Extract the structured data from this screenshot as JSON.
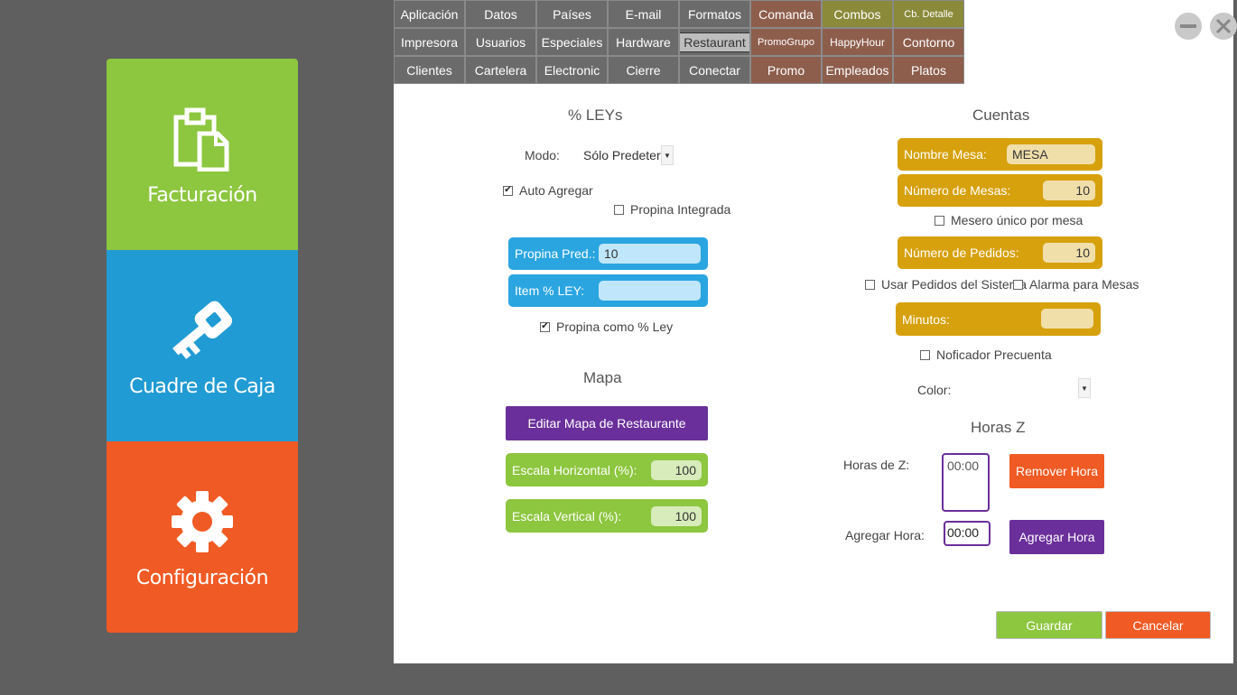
{
  "left_menu": {
    "items": [
      {
        "label": "Facturación",
        "icon": "clipboard-icon"
      },
      {
        "label": "Cuadre de Caja",
        "icon": "key-icon"
      },
      {
        "label": "Configuración",
        "icon": "gear-icon"
      }
    ]
  },
  "tabs": {
    "row1": [
      "Aplicación",
      "Datos",
      "Países",
      "E-mail",
      "Formatos",
      "Comanda",
      "Combos",
      "Cb. Detalle"
    ],
    "row2": [
      "Impresora",
      "Usuarios",
      "Especiales",
      "Hardware",
      "Restaurant",
      "PromoGrupo",
      "HappyHour",
      "Contorno"
    ],
    "row3": [
      "Clientes",
      "Cartelera",
      "Electronic",
      "Cierre",
      "Conectar",
      "Promo",
      "Empleados",
      "Platos"
    ],
    "active": "Restaurant"
  },
  "leys": {
    "title": "% LEYs",
    "modo_label": "Modo:",
    "modo_value": "Sólo Predeterr",
    "auto_agregar": "Auto Agregar",
    "propina_integrada": "Propina Integrada",
    "propina_pred_label": "Propina Pred.:",
    "propina_pred_value": "10",
    "item_ley_label": "Item % LEY:",
    "item_ley_value": "",
    "propina_como_ley": "Propina como % Ley"
  },
  "mapa": {
    "title": "Mapa",
    "edit_button": "Editar Mapa de Restaurante",
    "escala_h_label": "Escala Horizontal (%):",
    "escala_h_value": "100",
    "escala_v_label": "Escala Vertical (%):",
    "escala_v_value": "100"
  },
  "cuentas": {
    "title": "Cuentas",
    "nombre_mesa_label": "Nombre Mesa:",
    "nombre_mesa_value": "MESA",
    "numero_mesas_label": "Número de Mesas:",
    "numero_mesas_value": "10",
    "mesero_unico": "Mesero único por mesa",
    "numero_pedidos_label": "Número de Pedidos:",
    "numero_pedidos_value": "10",
    "usar_pedidos": "Usar Pedidos del Sistema",
    "alarma_mesas": "Alarma para Mesas",
    "minutos_label": "Minutos:",
    "minutos_value": "",
    "noficador": "Noficador Precuenta",
    "color_label": "Color:"
  },
  "horas_z": {
    "title": "Horas Z",
    "horas_label": "Horas de Z:",
    "horas_list_value": "00:00",
    "remover_button": "Remover Hora",
    "agregar_label": "Agregar Hora:",
    "agregar_value": "00:00",
    "agregar_button": "Agregar Hora"
  },
  "footer": {
    "guardar": "Guardar",
    "cancelar": "Cancelar"
  },
  "colors": {
    "green": "#8dc63f",
    "blue": "#219bd4",
    "orange": "#f05a24",
    "purple": "#6a2f9a",
    "gold": "#d6a10d"
  }
}
